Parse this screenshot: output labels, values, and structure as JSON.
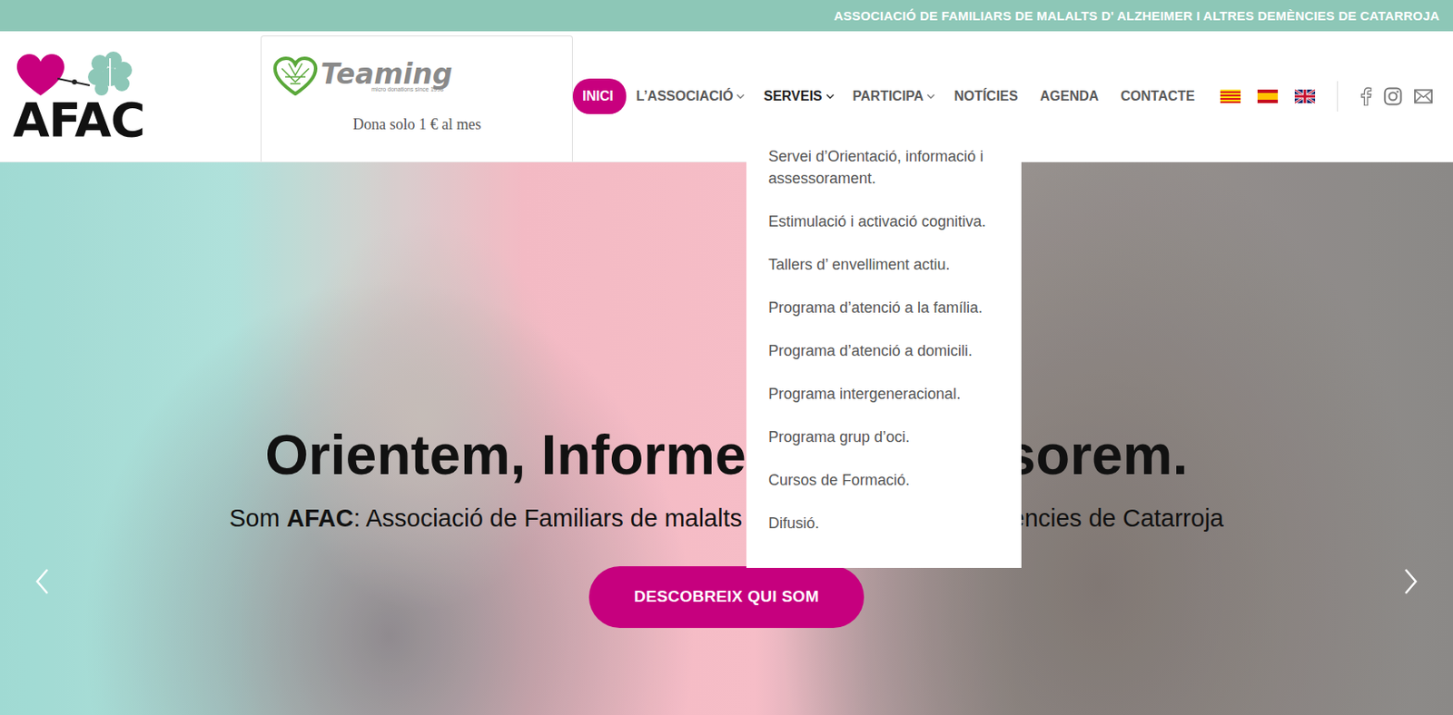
{
  "top_bar": {
    "text": "ASSOCIACIÓ DE FAMILIARS DE MALALTS D' ALZHEIMER I ALTRES DEMÈNCIES DE CATARROJA"
  },
  "logo": {
    "text": "AFAC"
  },
  "teaming": {
    "name": "Teaming",
    "tagline": "micro donations since 1998",
    "caption": "Dona solo 1 € al mes"
  },
  "nav": [
    {
      "label": "INICI",
      "selected": true,
      "dropdown": false,
      "expanded": false
    },
    {
      "label": "L’ASSOCIACIÓ",
      "selected": false,
      "dropdown": true,
      "expanded": false
    },
    {
      "label": "SERVEIS",
      "selected": false,
      "dropdown": true,
      "expanded": true
    },
    {
      "label": "PARTICIPA",
      "selected": false,
      "dropdown": true,
      "expanded": false
    },
    {
      "label": "NOTÍCIES",
      "selected": false,
      "dropdown": false,
      "expanded": false
    },
    {
      "label": "AGENDA",
      "selected": false,
      "dropdown": false,
      "expanded": false
    },
    {
      "label": "CONTACTE",
      "selected": false,
      "dropdown": false,
      "expanded": false
    }
  ],
  "dropdown": {
    "items": [
      "Servei d’Orientació, informació i assessorament.",
      "Estimulació i activació cognitiva.",
      "Tallers d’ envelliment actiu.",
      "Programa d’atenció a la família.",
      "Programa d’atenció a domicili.",
      "Programa intergeneracional.",
      "Programa grup d’oci.",
      "Cursos de Formació.",
      "Difusió."
    ]
  },
  "hero": {
    "headline": "Orientem, Informem i Assessorem.",
    "subtitle_prefix": "Som ",
    "subtitle_brand": "AFAC",
    "subtitle_rest": ": Associació de Familiars de malalts d’Alzheimer i altres demències de Catarroja",
    "button": "DESCOBREIX QUI SOM"
  }
}
